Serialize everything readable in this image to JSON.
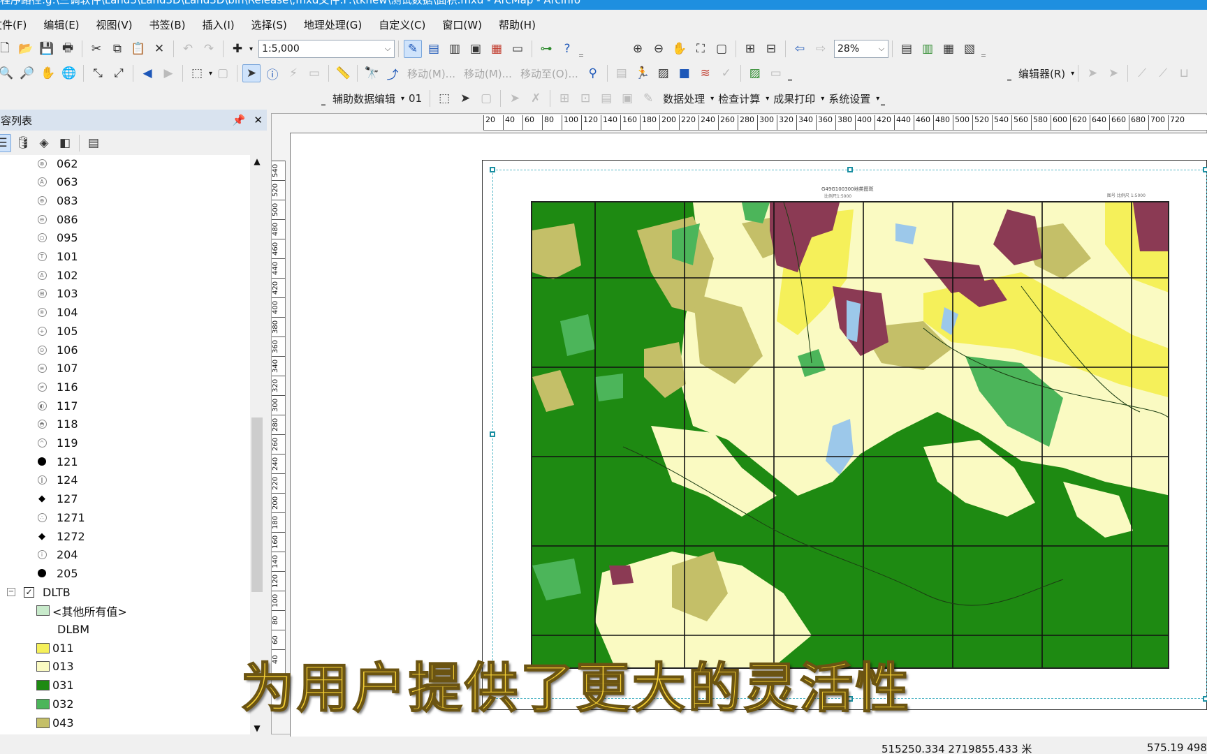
{
  "title_bar": "程序路径:g:\\三调软件\\Land3\\Land3D\\Land3D\\bin\\Release\\;mxd文件:F:\\tkhew\\测试数据\\面积.mxd - ArcMap - ArcInfo",
  "menu": [
    "文件(F)",
    "编辑(E)",
    "视图(V)",
    "书签(B)",
    "插入(I)",
    "选择(S)",
    "地理处理(G)",
    "自定义(C)",
    "窗口(W)",
    "帮助(H)"
  ],
  "toolbar": {
    "scale": "1:5,000",
    "zoom": "28%",
    "move_m1": "移动(M)...",
    "move_m2": "移动(M)...",
    "move_to": "移动至(O)...",
    "editor": "编辑器(R)",
    "aux_edit": "辅助数据编辑",
    "aux_num": "01",
    "data_proc": "数据处理",
    "check_calc": "检查计算",
    "print": "成果打印",
    "sys_settings": "系统设置"
  },
  "toc": {
    "title": "内容列表",
    "pin": "ᵖ",
    "close": "✕",
    "items": [
      {
        "label": "062",
        "sym": "⊗"
      },
      {
        "label": "063",
        "sym": "A"
      },
      {
        "label": "083",
        "sym": "⊕"
      },
      {
        "label": "086",
        "sym": "⊖"
      },
      {
        "label": "095",
        "sym": "○"
      },
      {
        "label": "101",
        "sym": "T"
      },
      {
        "label": "102",
        "sym": "A"
      },
      {
        "label": "103",
        "sym": "⊞"
      },
      {
        "label": "104",
        "sym": "※"
      },
      {
        "label": "105",
        "sym": "+"
      },
      {
        "label": "106",
        "sym": "⊙"
      },
      {
        "label": "107",
        "sym": "≡"
      },
      {
        "label": "116",
        "sym": "≠"
      },
      {
        "label": "117",
        "sym": "◐"
      },
      {
        "label": "118",
        "sym": "◓"
      },
      {
        "label": "119",
        "sym": "^"
      },
      {
        "label": "121",
        "sym": "●"
      },
      {
        "label": "124",
        "sym": "∥"
      },
      {
        "label": "127",
        "sym": "◆"
      },
      {
        "label": "1271",
        "sym": "∴"
      },
      {
        "label": "1272",
        "sym": "◆"
      },
      {
        "label": "204",
        "sym": "i"
      },
      {
        "label": "205",
        "sym": "●"
      }
    ],
    "layer": "DLTB",
    "other_values": "<其他所有值>",
    "field": "DLBM",
    "classes": [
      {
        "label": "011",
        "color": "#f5f05a"
      },
      {
        "label": "013",
        "color": "#fafac2"
      },
      {
        "label": "031",
        "color": "#1e8a12"
      },
      {
        "label": "032",
        "color": "#4cb55a"
      },
      {
        "label": "043",
        "color": "#c4bf68"
      }
    ]
  },
  "map": {
    "title": "G49G100300地类图斑",
    "subtitle": "比例尺1:5000",
    "note": "图号 比例尺 1:5000",
    "ruler_ticks": [
      "20",
      "40",
      "60",
      "80",
      "100",
      "120",
      "140",
      "160",
      "180",
      "200",
      "220",
      "240",
      "260",
      "280",
      "300",
      "320",
      "340",
      "360",
      "380",
      "400",
      "420",
      "440",
      "460",
      "480",
      "500",
      "520",
      "540",
      "560",
      "580",
      "600",
      "620",
      "640",
      "660",
      "680",
      "700",
      "720"
    ],
    "vruler_ticks": [
      "540",
      "520",
      "500",
      "480",
      "460",
      "440",
      "420",
      "400",
      "380",
      "360",
      "340",
      "320",
      "300",
      "280",
      "260",
      "240",
      "220",
      "200",
      "180",
      "160",
      "140",
      "120",
      "100",
      "80",
      "60",
      "40"
    ],
    "colors": {
      "forest": "#1e8a12",
      "light_green": "#4cb55a",
      "olive": "#c4bf68",
      "cream": "#fafac2",
      "yellow": "#f5f05a",
      "maroon": "#8b3a54",
      "water": "#9cc8ea"
    }
  },
  "status": {
    "coords": "515250.334  2719855.433 米",
    "page_size": "575.19  498"
  },
  "subtitle": "为用户提供了更大的灵活性"
}
